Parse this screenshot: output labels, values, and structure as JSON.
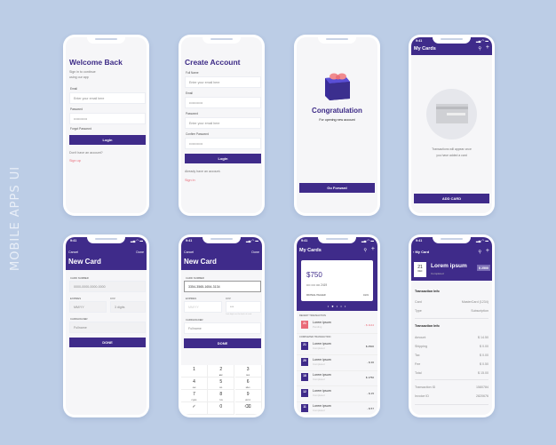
{
  "side_title": "MOBILE APPS UI",
  "colors": {
    "background": "#bccde6",
    "primary": "#3f2b8a",
    "accent": "#e96a78"
  },
  "login": {
    "title": "Welcome Back",
    "subtitle1": "Sign in to continue",
    "subtitle2": "using our app",
    "email_label": "Email",
    "email_placeholder": "Enter your email here",
    "password_label": "Password",
    "password_value": "••••••••••••",
    "forgot": "Forgot Password",
    "button": "Login",
    "no_account": "Don't have an account?",
    "signup": "Sign up"
  },
  "signup": {
    "title": "Create Account",
    "fullname_label": "Full Name",
    "fullname_placeholder": "Enter your email here",
    "email_label": "Email",
    "email_value": "••••••••••••",
    "password_label": "Password",
    "password_placeholder": "Enter your email here",
    "confirm_label": "Confirm Password",
    "confirm_value": "••••••••••••",
    "button": "Login",
    "have_account": "Already have an account.",
    "signin": "Sign in"
  },
  "congrats": {
    "title": "Congratulation",
    "subtitle": "For opening new account",
    "button": "Go Forward"
  },
  "empty_cards": {
    "time": "9:41",
    "title": "My Cards",
    "message1": "Transactions will appear once",
    "message2": "you have added a card",
    "button": "ADD CARD"
  },
  "new_card": {
    "time": "9:41",
    "cancel": "Cancel",
    "done": "Done",
    "title": "New Card",
    "card_number_label": "CARD NUMBER",
    "card_number_placeholder": "0000-0000-0000-0000",
    "expires_label": "EXPIRES",
    "expires_placeholder": "MM/YY",
    "cvv_label": "CVV",
    "cvv_placeholder": "3 digits",
    "cardholder_label": "CARDHOLDER",
    "cardholder_placeholder": "Fullname",
    "button": "DONE"
  },
  "new_card_filled": {
    "time": "9:41",
    "cancel": "Cancel",
    "done": "Done",
    "title": "New Card",
    "card_number_label": "CARD NUMBER",
    "card_number_value": "3354-3565-1654-3134",
    "expires_label": "EXPIRES",
    "expires_placeholder": "MM/YY",
    "cvv_label": "CVV",
    "cvv_value": "***",
    "cvv_hint": "Last digits on the back of card",
    "cardholder_label": "CARDHOLDER",
    "cardholder_placeholder": "Fullname",
    "button": "DONE",
    "keypad": [
      {
        "k": "1",
        "s": ""
      },
      {
        "k": "2",
        "s": "ABC"
      },
      {
        "k": "3",
        "s": "DEF"
      },
      {
        "k": "4",
        "s": "GHI"
      },
      {
        "k": "5",
        "s": "JKL"
      },
      {
        "k": "6",
        "s": "MNO"
      },
      {
        "k": "7",
        "s": "PQRS"
      },
      {
        "k": "8",
        "s": "TUV"
      },
      {
        "k": "9",
        "s": "WXYZ"
      },
      {
        "k": "✓",
        "s": ""
      },
      {
        "k": "0",
        "s": ""
      },
      {
        "k": "⌫",
        "s": ""
      }
    ]
  },
  "my_cards": {
    "time": "9:41",
    "title": "My Cards",
    "balance": "$750",
    "card_digits": "•••• •••• •••• 2419",
    "card_holder": "MICHEAL HAGGER",
    "card_expiry": "10/21",
    "recent_label": "RECENT TRANSACTION",
    "completed_label": "COMPLETED TRANSACTION",
    "recent": [
      {
        "day": "21",
        "name": "Lorem ipsum",
        "status": "Pending",
        "amount": "- $ 1144"
      }
    ],
    "completed": [
      {
        "day": "21",
        "name": "Lorem ipsum",
        "status": "Completed",
        "amount": "$ 2500"
      },
      {
        "day": "20",
        "name": "Lorem ipsum",
        "status": "Completed",
        "amount": "- $ 36"
      },
      {
        "day": "18",
        "name": "Lorem ipsum",
        "status": "Completed",
        "amount": "$ 1750"
      },
      {
        "day": "12",
        "name": "Lorem ipsum",
        "status": "Completed",
        "amount": "- $ 15"
      },
      {
        "day": "11",
        "name": "Lorem ipsum",
        "status": "Completed",
        "amount": "- $ 57"
      }
    ]
  },
  "card_detail": {
    "time": "9:41",
    "back": "My Card",
    "day": "21",
    "month": "DEC",
    "title": "Lorem ipsum",
    "status": "Completed",
    "amount_badge": "$ 2500",
    "section1": "Transaction Info",
    "card_label": "Card",
    "card_value": "MasterCard (1234)",
    "type_label": "Type",
    "type_value": "Subscription",
    "section2": "Transaction Info",
    "rows": [
      {
        "label": "Amount",
        "value": "$ 14.50"
      },
      {
        "label": "Shipping",
        "value": "$ 0.00"
      },
      {
        "label": "Tax",
        "value": "$ 0.00"
      },
      {
        "label": "Fee",
        "value": "$ 0.50"
      },
      {
        "label": "Total",
        "value": "$ 15.00"
      }
    ],
    "transaction_id_label": "Transaction ID",
    "transaction_id": "1580784",
    "invoice_id_label": "Invoice ID",
    "invoice_id": "2820676"
  }
}
